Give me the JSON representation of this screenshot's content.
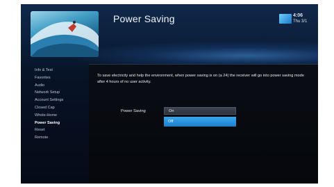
{
  "header": {
    "title": "Power Saving",
    "clock_time": "4:06",
    "clock_date": "Thu 3/1"
  },
  "menu": {
    "items": [
      {
        "label": "Info & Test"
      },
      {
        "label": "Favorites"
      },
      {
        "label": "Audio"
      },
      {
        "label": "Network Setup"
      },
      {
        "label": "Account Settings"
      },
      {
        "label": "Closed Cap"
      },
      {
        "label": "Whole-Home"
      },
      {
        "label": "Power Saving"
      },
      {
        "label": "Reset"
      },
      {
        "label": "Remote"
      }
    ],
    "active_index": 7
  },
  "panel": {
    "description": "To save electricity and help the environment, when power saving is on (a 24) the receiver will go into power saving mode after 4 hours of no user activity.",
    "field_label": "Power Saving",
    "selected_value": "On",
    "highlighted_option": "Off"
  },
  "colors": {
    "accent": "#2a8fe0",
    "background": "#071326",
    "text": "#e6ebf2"
  }
}
